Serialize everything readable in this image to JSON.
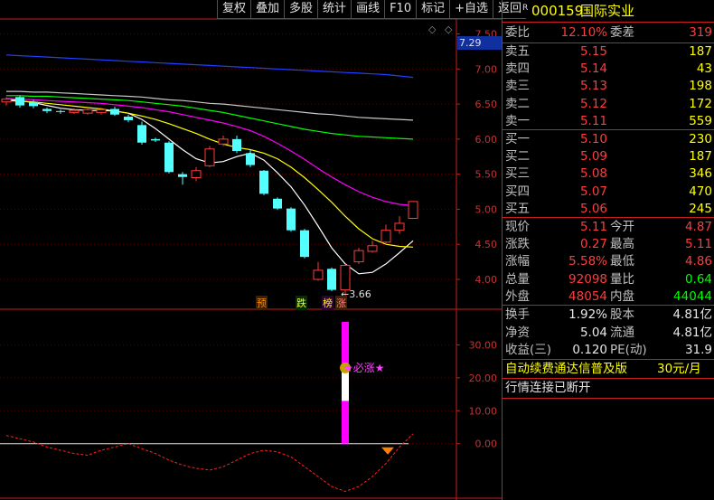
{
  "toolbar": {
    "buttons": [
      "复权",
      "叠加",
      "多股",
      "统计",
      "画线",
      "F10",
      "标记",
      "+自选",
      "返回"
    ]
  },
  "chart": {
    "price_axis_ticks": [
      "7.50",
      "7.00",
      "6.50",
      "6.00",
      "5.50",
      "5.00",
      "4.50",
      "4.00"
    ],
    "indicator_axis_ticks": [
      "30.00",
      "20.00",
      "10.00",
      "0.00"
    ],
    "current_price_marker": "7.29",
    "low_price_label": "3.66",
    "signal_labels": [
      "预",
      "跌",
      "榜",
      "涨"
    ],
    "signal_text": "★必涨★",
    "signal_icon": "money-bag-icon",
    "diamond_icon": "diamond-icon"
  },
  "chart_data": {
    "type": "candlestick",
    "candles": [
      {
        "open": 6.53,
        "close": 6.57,
        "high": 6.6,
        "low": 6.48,
        "color": "red"
      },
      {
        "open": 6.6,
        "close": 6.48,
        "high": 6.62,
        "low": 6.45,
        "color": "cyan"
      },
      {
        "open": 6.53,
        "close": 6.47,
        "high": 6.56,
        "low": 6.44,
        "color": "cyan"
      },
      {
        "open": 6.43,
        "close": 6.4,
        "high": 6.45,
        "low": 6.37,
        "color": "cyan"
      },
      {
        "open": 6.4,
        "close": 6.39,
        "high": 6.42,
        "low": 6.36,
        "color": "cyan"
      },
      {
        "open": 6.38,
        "close": 6.41,
        "high": 6.44,
        "low": 6.36,
        "color": "red"
      },
      {
        "open": 6.37,
        "close": 6.42,
        "high": 6.45,
        "low": 6.35,
        "color": "red"
      },
      {
        "open": 6.38,
        "close": 6.42,
        "high": 6.45,
        "low": 6.35,
        "color": "red"
      },
      {
        "open": 6.43,
        "close": 6.35,
        "high": 6.46,
        "low": 6.33,
        "color": "cyan"
      },
      {
        "open": 6.32,
        "close": 6.27,
        "high": 6.35,
        "low": 6.24,
        "color": "cyan"
      },
      {
        "open": 6.2,
        "close": 5.95,
        "high": 6.25,
        "low": 5.92,
        "color": "cyan"
      },
      {
        "open": 6.0,
        "close": 5.98,
        "high": 6.02,
        "low": 5.96,
        "color": "cyan"
      },
      {
        "open": 5.95,
        "close": 5.53,
        "high": 5.97,
        "low": 5.51,
        "color": "cyan"
      },
      {
        "open": 5.5,
        "close": 5.46,
        "high": 5.53,
        "low": 5.35,
        "color": "cyan"
      },
      {
        "open": 5.45,
        "close": 5.55,
        "high": 5.6,
        "low": 5.4,
        "color": "red"
      },
      {
        "open": 5.62,
        "close": 5.86,
        "high": 5.9,
        "low": 5.6,
        "color": "red"
      },
      {
        "open": 5.93,
        "close": 6.0,
        "high": 6.05,
        "low": 5.9,
        "color": "red"
      },
      {
        "open": 6.0,
        "close": 5.83,
        "high": 6.05,
        "low": 5.8,
        "color": "cyan"
      },
      {
        "open": 5.8,
        "close": 5.63,
        "high": 5.85,
        "low": 5.6,
        "color": "cyan"
      },
      {
        "open": 5.55,
        "close": 5.22,
        "high": 5.56,
        "low": 5.2,
        "color": "cyan"
      },
      {
        "open": 5.15,
        "close": 5.01,
        "high": 5.17,
        "low": 4.99,
        "color": "cyan"
      },
      {
        "open": 5.01,
        "close": 4.7,
        "high": 5.03,
        "low": 4.68,
        "color": "cyan"
      },
      {
        "open": 4.7,
        "close": 4.32,
        "high": 4.72,
        "low": 4.3,
        "color": "cyan"
      },
      {
        "open": 4.0,
        "close": 4.13,
        "high": 4.25,
        "low": 3.98,
        "color": "red"
      },
      {
        "open": 4.15,
        "close": 3.85,
        "high": 4.17,
        "low": 3.83,
        "color": "cyan"
      },
      {
        "open": 3.85,
        "close": 4.2,
        "high": 4.22,
        "low": 3.66,
        "color": "red"
      },
      {
        "open": 4.25,
        "close": 4.41,
        "high": 4.45,
        "low": 4.22,
        "color": "red"
      },
      {
        "open": 4.4,
        "close": 4.48,
        "high": 4.55,
        "low": 4.38,
        "color": "red"
      },
      {
        "open": 4.53,
        "close": 4.7,
        "high": 4.78,
        "low": 4.5,
        "color": "red"
      },
      {
        "open": 4.7,
        "close": 4.8,
        "high": 4.9,
        "low": 4.65,
        "color": "red"
      },
      {
        "open": 4.87,
        "close": 5.11,
        "high": 5.11,
        "low": 4.86,
        "color": "red"
      }
    ],
    "moving_averages": [
      {
        "name": "",
        "color": "#ffffff",
        "values": [
          6.57,
          6.55,
          6.52,
          6.48,
          6.44,
          6.42,
          6.41,
          6.41,
          6.4,
          6.37,
          6.28,
          6.15,
          6.0,
          5.85,
          5.72,
          5.66,
          5.68,
          5.75,
          5.8,
          5.7,
          5.52,
          5.32,
          5.06,
          4.76,
          4.45,
          4.22,
          4.08,
          4.1,
          4.22,
          4.38,
          4.55
        ]
      },
      {
        "name": "",
        "color": "#ffff00",
        "values": [
          6.55,
          6.54,
          6.53,
          6.51,
          6.49,
          6.47,
          6.45,
          6.43,
          6.4,
          6.37,
          6.33,
          6.28,
          6.22,
          6.15,
          6.08,
          6.0,
          5.93,
          5.88,
          5.85,
          5.8,
          5.72,
          5.6,
          5.45,
          5.28,
          5.1,
          4.9,
          4.72,
          4.58,
          4.5,
          4.47,
          4.46
        ]
      },
      {
        "name": "",
        "color": "#ff00ff",
        "values": [
          6.58,
          6.57,
          6.56,
          6.55,
          6.54,
          6.53,
          6.52,
          6.51,
          6.49,
          6.47,
          6.45,
          6.42,
          6.39,
          6.35,
          6.31,
          6.27,
          6.23,
          6.18,
          6.12,
          6.04,
          5.94,
          5.83,
          5.71,
          5.58,
          5.46,
          5.35,
          5.25,
          5.17,
          5.11,
          5.07,
          5.05
        ]
      },
      {
        "name": "",
        "color": "#00ff00",
        "values": [
          6.62,
          6.62,
          6.61,
          6.61,
          6.6,
          6.59,
          6.58,
          6.57,
          6.56,
          6.55,
          6.53,
          6.51,
          6.49,
          6.47,
          6.44,
          6.41,
          6.38,
          6.34,
          6.3,
          6.26,
          6.22,
          6.18,
          6.14,
          6.11,
          6.08,
          6.06,
          6.04,
          6.03,
          6.02,
          6.01,
          6.0
        ]
      },
      {
        "name": "",
        "color": "#c8c8c8",
        "values": [
          6.68,
          6.68,
          6.67,
          6.67,
          6.66,
          6.65,
          6.64,
          6.63,
          6.62,
          6.61,
          6.6,
          6.58,
          6.56,
          6.55,
          6.53,
          6.51,
          6.5,
          6.48,
          6.46,
          6.44,
          6.42,
          6.4,
          6.38,
          6.36,
          6.35,
          6.33,
          6.31,
          6.3,
          6.29,
          6.28,
          6.27
        ]
      },
      {
        "name": "",
        "color": "#2040ff",
        "values": [
          7.2,
          7.19,
          7.18,
          7.17,
          7.16,
          7.15,
          7.14,
          7.13,
          7.12,
          7.11,
          7.1,
          7.09,
          7.08,
          7.07,
          7.06,
          7.05,
          7.04,
          7.03,
          7.02,
          7.01,
          7.0,
          6.99,
          6.98,
          6.97,
          6.96,
          6.95,
          6.94,
          6.93,
          6.92,
          6.9,
          6.88
        ]
      }
    ],
    "indicator_bar": {
      "index": 25,
      "value": 37
    },
    "indicator_curve": [
      2.5,
      1.5,
      0.5,
      -1,
      -2,
      -3,
      -3.5,
      -2,
      -1,
      0,
      -1.5,
      -3,
      -5,
      -6.5,
      -7.5,
      -8,
      -7,
      -5,
      -3,
      -2,
      -2.5,
      -4,
      -7,
      -10,
      -13,
      -14.5,
      -13,
      -10,
      -6,
      -1,
      3
    ],
    "ylim": [
      3.6,
      7.7
    ],
    "indicator_ylim": [
      -16,
      40
    ]
  },
  "quote": {
    "flag": "R",
    "code": "000159",
    "name": "国际实业",
    "weibi_label": "委比",
    "weibi_value": "12.10%",
    "weicha_label": "委差",
    "weicha_value": "319",
    "asks": [
      {
        "label": "卖五",
        "price": "5.15",
        "volume": "187"
      },
      {
        "label": "卖四",
        "price": "5.14",
        "volume": "43"
      },
      {
        "label": "卖三",
        "price": "5.13",
        "volume": "198"
      },
      {
        "label": "卖二",
        "price": "5.12",
        "volume": "172"
      },
      {
        "label": "卖一",
        "price": "5.11",
        "volume": "559"
      }
    ],
    "bids": [
      {
        "label": "买一",
        "price": "5.10",
        "volume": "230"
      },
      {
        "label": "买二",
        "price": "5.09",
        "volume": "187"
      },
      {
        "label": "买三",
        "price": "5.08",
        "volume": "346"
      },
      {
        "label": "买四",
        "price": "5.07",
        "volume": "470"
      },
      {
        "label": "买五",
        "price": "5.06",
        "volume": "245"
      }
    ],
    "stats": [
      {
        "l1": "现价",
        "v1": "5.11",
        "l2": "今开",
        "v2": "4.87"
      },
      {
        "l1": "涨跌",
        "v1": "0.27",
        "l2": "最高",
        "v2": "5.11"
      },
      {
        "l1": "涨幅",
        "v1": "5.58%",
        "l2": "最低",
        "v2": "4.86"
      },
      {
        "l1": "总量",
        "v1": "92098",
        "l2": "量比",
        "v2": "0.64"
      },
      {
        "l1": "外盘",
        "v1": "48054",
        "l2": "内盘",
        "v2": "44044"
      }
    ],
    "stats2": [
      {
        "l1": "换手",
        "v1": "1.92%",
        "l2": "股本",
        "v2": "4.81亿"
      },
      {
        "l1": "净资",
        "v1": "5.04",
        "l2": "流通",
        "v2": "4.81亿"
      },
      {
        "l1": "收益(三)",
        "v1": "0.120",
        "l2": "PE(动)",
        "v2": "31.9"
      }
    ],
    "promo_text": "自动续费通达信普及版",
    "promo_price": "30元/月",
    "status_text": "行情连接已断开"
  }
}
